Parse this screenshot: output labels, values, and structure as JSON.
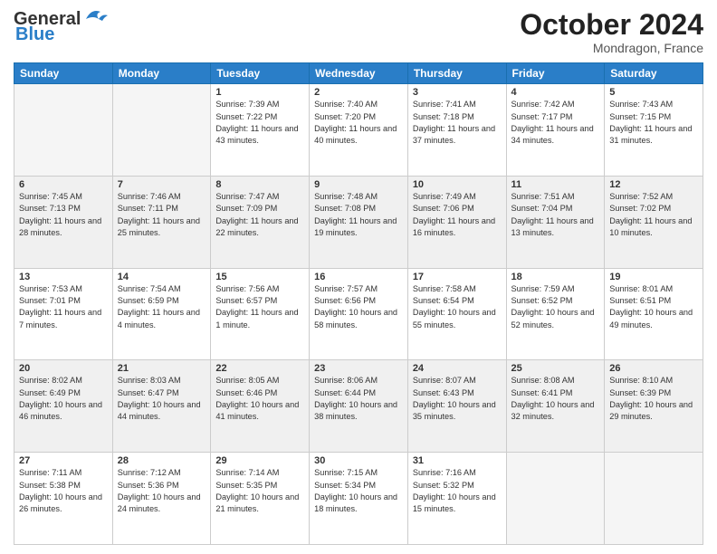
{
  "header": {
    "logo_line1": "General",
    "logo_line2": "Blue",
    "month": "October 2024",
    "location": "Mondragon, France"
  },
  "weekdays": [
    "Sunday",
    "Monday",
    "Tuesday",
    "Wednesday",
    "Thursday",
    "Friday",
    "Saturday"
  ],
  "weeks": [
    {
      "shaded": false,
      "days": [
        {
          "num": "",
          "sunrise": "",
          "sunset": "",
          "daylight": ""
        },
        {
          "num": "",
          "sunrise": "",
          "sunset": "",
          "daylight": ""
        },
        {
          "num": "1",
          "sunrise": "Sunrise: 7:39 AM",
          "sunset": "Sunset: 7:22 PM",
          "daylight": "Daylight: 11 hours and 43 minutes."
        },
        {
          "num": "2",
          "sunrise": "Sunrise: 7:40 AM",
          "sunset": "Sunset: 7:20 PM",
          "daylight": "Daylight: 11 hours and 40 minutes."
        },
        {
          "num": "3",
          "sunrise": "Sunrise: 7:41 AM",
          "sunset": "Sunset: 7:18 PM",
          "daylight": "Daylight: 11 hours and 37 minutes."
        },
        {
          "num": "4",
          "sunrise": "Sunrise: 7:42 AM",
          "sunset": "Sunset: 7:17 PM",
          "daylight": "Daylight: 11 hours and 34 minutes."
        },
        {
          "num": "5",
          "sunrise": "Sunrise: 7:43 AM",
          "sunset": "Sunset: 7:15 PM",
          "daylight": "Daylight: 11 hours and 31 minutes."
        }
      ]
    },
    {
      "shaded": true,
      "days": [
        {
          "num": "6",
          "sunrise": "Sunrise: 7:45 AM",
          "sunset": "Sunset: 7:13 PM",
          "daylight": "Daylight: 11 hours and 28 minutes."
        },
        {
          "num": "7",
          "sunrise": "Sunrise: 7:46 AM",
          "sunset": "Sunset: 7:11 PM",
          "daylight": "Daylight: 11 hours and 25 minutes."
        },
        {
          "num": "8",
          "sunrise": "Sunrise: 7:47 AM",
          "sunset": "Sunset: 7:09 PM",
          "daylight": "Daylight: 11 hours and 22 minutes."
        },
        {
          "num": "9",
          "sunrise": "Sunrise: 7:48 AM",
          "sunset": "Sunset: 7:08 PM",
          "daylight": "Daylight: 11 hours and 19 minutes."
        },
        {
          "num": "10",
          "sunrise": "Sunrise: 7:49 AM",
          "sunset": "Sunset: 7:06 PM",
          "daylight": "Daylight: 11 hours and 16 minutes."
        },
        {
          "num": "11",
          "sunrise": "Sunrise: 7:51 AM",
          "sunset": "Sunset: 7:04 PM",
          "daylight": "Daylight: 11 hours and 13 minutes."
        },
        {
          "num": "12",
          "sunrise": "Sunrise: 7:52 AM",
          "sunset": "Sunset: 7:02 PM",
          "daylight": "Daylight: 11 hours and 10 minutes."
        }
      ]
    },
    {
      "shaded": false,
      "days": [
        {
          "num": "13",
          "sunrise": "Sunrise: 7:53 AM",
          "sunset": "Sunset: 7:01 PM",
          "daylight": "Daylight: 11 hours and 7 minutes."
        },
        {
          "num": "14",
          "sunrise": "Sunrise: 7:54 AM",
          "sunset": "Sunset: 6:59 PM",
          "daylight": "Daylight: 11 hours and 4 minutes."
        },
        {
          "num": "15",
          "sunrise": "Sunrise: 7:56 AM",
          "sunset": "Sunset: 6:57 PM",
          "daylight": "Daylight: 11 hours and 1 minute."
        },
        {
          "num": "16",
          "sunrise": "Sunrise: 7:57 AM",
          "sunset": "Sunset: 6:56 PM",
          "daylight": "Daylight: 10 hours and 58 minutes."
        },
        {
          "num": "17",
          "sunrise": "Sunrise: 7:58 AM",
          "sunset": "Sunset: 6:54 PM",
          "daylight": "Daylight: 10 hours and 55 minutes."
        },
        {
          "num": "18",
          "sunrise": "Sunrise: 7:59 AM",
          "sunset": "Sunset: 6:52 PM",
          "daylight": "Daylight: 10 hours and 52 minutes."
        },
        {
          "num": "19",
          "sunrise": "Sunrise: 8:01 AM",
          "sunset": "Sunset: 6:51 PM",
          "daylight": "Daylight: 10 hours and 49 minutes."
        }
      ]
    },
    {
      "shaded": true,
      "days": [
        {
          "num": "20",
          "sunrise": "Sunrise: 8:02 AM",
          "sunset": "Sunset: 6:49 PM",
          "daylight": "Daylight: 10 hours and 46 minutes."
        },
        {
          "num": "21",
          "sunrise": "Sunrise: 8:03 AM",
          "sunset": "Sunset: 6:47 PM",
          "daylight": "Daylight: 10 hours and 44 minutes."
        },
        {
          "num": "22",
          "sunrise": "Sunrise: 8:05 AM",
          "sunset": "Sunset: 6:46 PM",
          "daylight": "Daylight: 10 hours and 41 minutes."
        },
        {
          "num": "23",
          "sunrise": "Sunrise: 8:06 AM",
          "sunset": "Sunset: 6:44 PM",
          "daylight": "Daylight: 10 hours and 38 minutes."
        },
        {
          "num": "24",
          "sunrise": "Sunrise: 8:07 AM",
          "sunset": "Sunset: 6:43 PM",
          "daylight": "Daylight: 10 hours and 35 minutes."
        },
        {
          "num": "25",
          "sunrise": "Sunrise: 8:08 AM",
          "sunset": "Sunset: 6:41 PM",
          "daylight": "Daylight: 10 hours and 32 minutes."
        },
        {
          "num": "26",
          "sunrise": "Sunrise: 8:10 AM",
          "sunset": "Sunset: 6:39 PM",
          "daylight": "Daylight: 10 hours and 29 minutes."
        }
      ]
    },
    {
      "shaded": false,
      "days": [
        {
          "num": "27",
          "sunrise": "Sunrise: 7:11 AM",
          "sunset": "Sunset: 5:38 PM",
          "daylight": "Daylight: 10 hours and 26 minutes."
        },
        {
          "num": "28",
          "sunrise": "Sunrise: 7:12 AM",
          "sunset": "Sunset: 5:36 PM",
          "daylight": "Daylight: 10 hours and 24 minutes."
        },
        {
          "num": "29",
          "sunrise": "Sunrise: 7:14 AM",
          "sunset": "Sunset: 5:35 PM",
          "daylight": "Daylight: 10 hours and 21 minutes."
        },
        {
          "num": "30",
          "sunrise": "Sunrise: 7:15 AM",
          "sunset": "Sunset: 5:34 PM",
          "daylight": "Daylight: 10 hours and 18 minutes."
        },
        {
          "num": "31",
          "sunrise": "Sunrise: 7:16 AM",
          "sunset": "Sunset: 5:32 PM",
          "daylight": "Daylight: 10 hours and 15 minutes."
        },
        {
          "num": "",
          "sunrise": "",
          "sunset": "",
          "daylight": ""
        },
        {
          "num": "",
          "sunrise": "",
          "sunset": "",
          "daylight": ""
        }
      ]
    }
  ]
}
